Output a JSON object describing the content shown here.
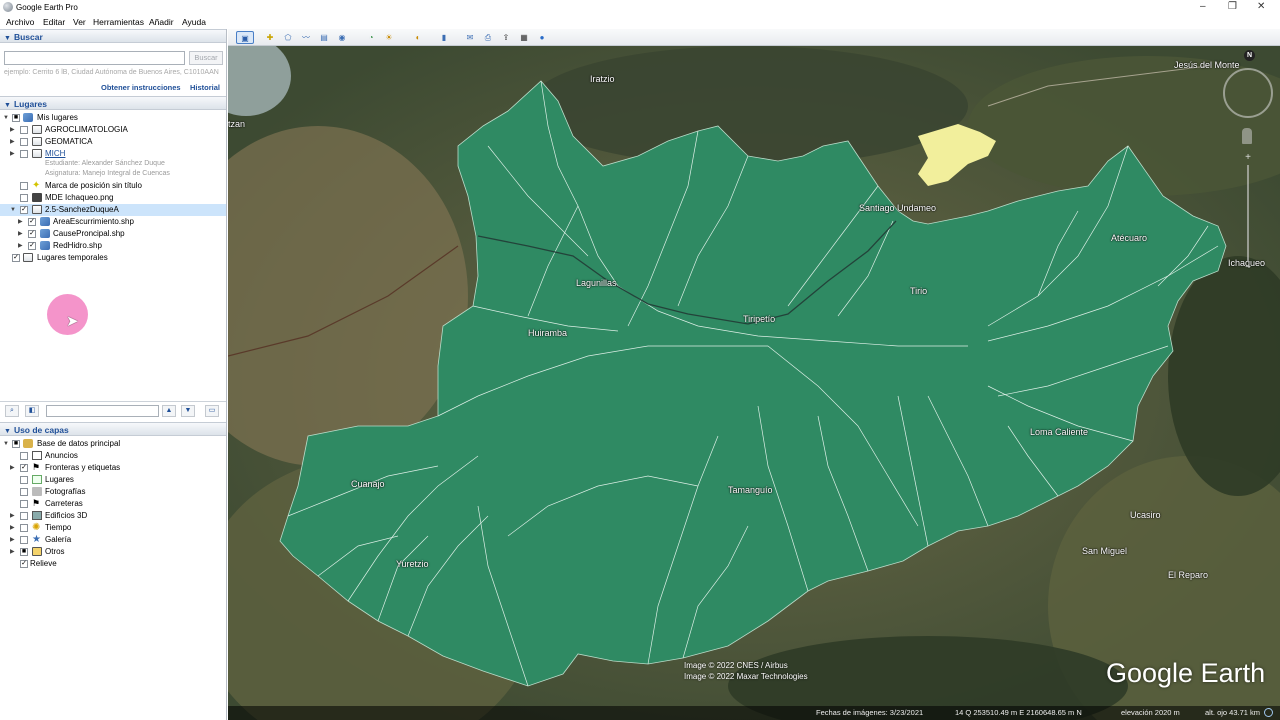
{
  "window": {
    "title": "Google Earth Pro",
    "minimize": "–",
    "restore": "❐",
    "close": "✕"
  },
  "menu": [
    "Archivo",
    "Editar",
    "Ver",
    "Herramientas",
    "Añadir",
    "Ayuda"
  ],
  "search": {
    "header": "Buscar",
    "button": "Buscar",
    "hint": "ejemplo: Cerrito 6 lB, Ciudad Autónoma de Buenos Aires, C1010AAN",
    "directions": "Obtener instrucciones",
    "history": "Historial"
  },
  "places": {
    "header": "Lugares",
    "items": [
      {
        "label": "Mis lugares"
      },
      {
        "label": "AGROCLIMATOLOGIA"
      },
      {
        "label": "GEOMATICA"
      },
      {
        "label": "MICH"
      },
      {
        "label": "Estudiante: Alexander Sánchez Duque"
      },
      {
        "label": "Asignatura: Manejo Integral de Cuencas"
      },
      {
        "label": "Marca de posición sin título"
      },
      {
        "label": "MDE Ichaqueo.png"
      },
      {
        "label": "2.5-SanchezDuqueA"
      },
      {
        "label": "AreaEscurrimiento.shp"
      },
      {
        "label": "CauseProncipal.shp"
      },
      {
        "label": "RedHidro.shp"
      },
      {
        "label": "Lugares temporales"
      }
    ]
  },
  "layers": {
    "header": "Uso de capas",
    "items": [
      {
        "label": "Base de datos principal"
      },
      {
        "label": "Anuncios"
      },
      {
        "label": "Fronteras y etiquetas"
      },
      {
        "label": "Lugares"
      },
      {
        "label": "Fotografías"
      },
      {
        "label": "Carreteras"
      },
      {
        "label": "Edificios 3D"
      },
      {
        "label": "Tiempo"
      },
      {
        "label": "Galería"
      },
      {
        "label": "Otros"
      },
      {
        "label": "Relieve"
      }
    ]
  },
  "map": {
    "towns": [
      "Iratzio",
      "Jesús del Monte",
      "tzan",
      "Santiago Undameo",
      "Atécuaro",
      "Ichaqueo",
      "Lagunillas",
      "Tiripetío",
      "Tirio",
      "Huiramba",
      "Loma Caliente",
      "Cuanajo",
      "Tamanguío",
      "Ucasiro",
      "San Miguel",
      "El Reparo",
      "Yuretzio"
    ],
    "attribution": [
      "Image © 2022 CNES / Airbus",
      "Image © 2022 Maxar Technologies"
    ],
    "logo": "Google Earth",
    "north": "N"
  },
  "status": {
    "imagery_date": "Fechas de imágenes: 3/23/2021",
    "coords": "14 Q 253510.49 m E 2160648.65 m N",
    "elevation": "elevación 2020 m",
    "eye_alt": "alt. ojo 43.71 km"
  },
  "colors": {
    "watershed": "#2f8a63",
    "streams": "#dcefe6",
    "header_text": "#1f4f98"
  }
}
